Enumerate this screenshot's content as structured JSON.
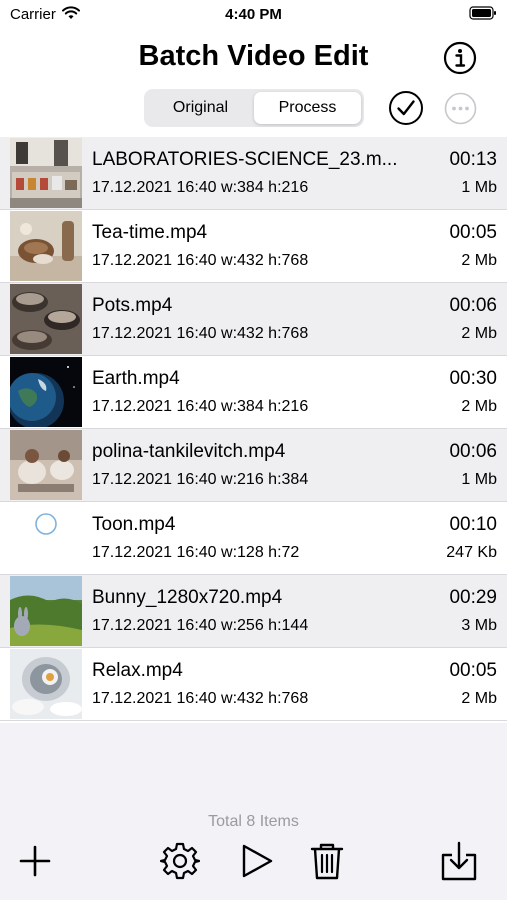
{
  "status_bar": {
    "carrier": "Carrier",
    "time": "4:40 PM"
  },
  "header": {
    "title": "Batch Video Edit"
  },
  "segmented": {
    "original": "Original",
    "process": "Process",
    "selected": "Process"
  },
  "videos": [
    {
      "name": "LABORATORIES-SCIENCE_23.m...",
      "date": "17.12.2021 16:40",
      "width": "w:384",
      "height": "h:216",
      "duration": "00:13",
      "size": "1 Mb"
    },
    {
      "name": "Tea-time.mp4",
      "date": "17.12.2021 16:40",
      "width": "w:432",
      "height": "h:768",
      "duration": "00:05",
      "size": "2 Mb"
    },
    {
      "name": "Pots.mp4",
      "date": "17.12.2021 16:40",
      "width": "w:432",
      "height": "h:768",
      "duration": "00:06",
      "size": "2 Mb"
    },
    {
      "name": "Earth.mp4",
      "date": "17.12.2021 16:40",
      "width": "w:384",
      "height": "h:216",
      "duration": "00:30",
      "size": "2 Mb"
    },
    {
      "name": "polina-tankilevitch.mp4",
      "date": "17.12.2021 16:40",
      "width": "w:216",
      "height": "h:384",
      "duration": "00:06",
      "size": "1 Mb"
    },
    {
      "name": "Toon.mp4",
      "date": "17.12.2021 16:40",
      "width": "w:128",
      "height": "h:72",
      "duration": "00:10",
      "size": "247 Kb"
    },
    {
      "name": "Bunny_1280x720.mp4",
      "date": "17.12.2021 16:40",
      "width": "w:256",
      "height": "h:144",
      "duration": "00:29",
      "size": "3 Mb"
    },
    {
      "name": "Relax.mp4",
      "date": "17.12.2021 16:40",
      "width": "w:432",
      "height": "h:768",
      "duration": "00:05",
      "size": "2 Mb"
    }
  ],
  "footer": {
    "total": "Total 8 Items"
  },
  "toolbar_icons": [
    "plus-icon",
    "gear-icon",
    "play-icon",
    "trash-icon",
    "export-icon"
  ]
}
